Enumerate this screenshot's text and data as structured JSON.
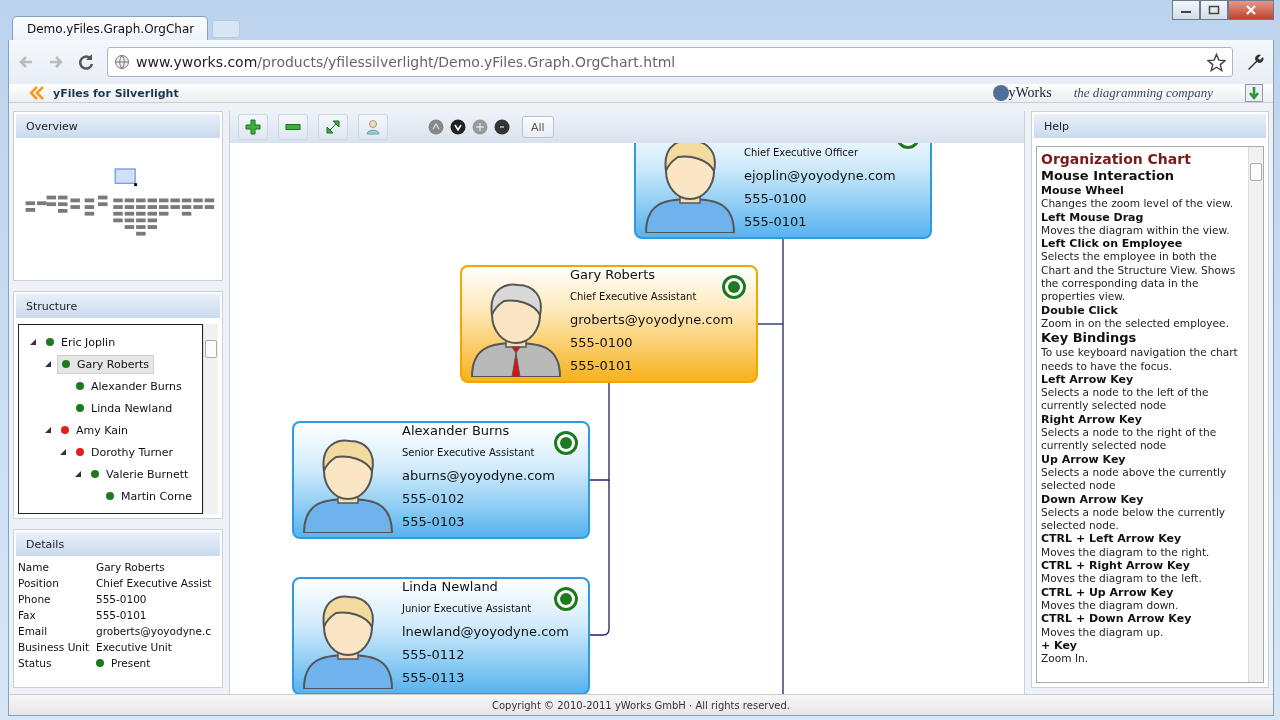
{
  "browser": {
    "tab_title": "Demo.yFiles.Graph.OrgChar",
    "url_host": "www.yworks.com",
    "url_path": "/products/yfilessilverlight/Demo.yFiles.Graph.OrgChart.html"
  },
  "page_header": {
    "product": "yFiles for Silverlight",
    "logo_text": "yWorks",
    "tagline": "the diagramming company"
  },
  "overview": {
    "title": "Overview"
  },
  "structure": {
    "title": "Structure",
    "items": [
      {
        "name": "Eric Joplin",
        "color": "#1e7a1e",
        "expanded": true,
        "selected": false,
        "children": [
          {
            "name": "Gary Roberts",
            "color": "#1e7a1e",
            "expanded": true,
            "selected": true,
            "children": [
              {
                "name": "Alexander Burns",
                "color": "#1e7a1e",
                "selected": false
              },
              {
                "name": "Linda Newland",
                "color": "#1e7a1e",
                "selected": false
              }
            ]
          },
          {
            "name": "Amy Kain",
            "color": "#e02020",
            "expanded": true,
            "selected": false,
            "children": [
              {
                "name": "Dorothy Turner",
                "color": "#e02020",
                "expanded": true,
                "selected": false,
                "children": [
                  {
                    "name": "Valerie Burnett",
                    "color": "#1e7a1e",
                    "expanded": true,
                    "selected": false,
                    "children": [
                      {
                        "name": "Martin Corne",
                        "color": "#1e7a1e",
                        "selected": false
                      }
                    ]
                  }
                ]
              }
            ]
          }
        ]
      }
    ]
  },
  "details": {
    "title": "Details",
    "rows": [
      {
        "label": "Name",
        "value": "Gary Roberts"
      },
      {
        "label": "Position",
        "value": "Chief Executive Assist"
      },
      {
        "label": "Phone",
        "value": "555-0100"
      },
      {
        "label": "Fax",
        "value": "555-0101"
      },
      {
        "label": "Email",
        "value": "groberts@yoyodyne.c"
      },
      {
        "label": "Business Unit",
        "value": "Executive Unit"
      },
      {
        "label": "Status",
        "value": "Present",
        "color": "#1e7a1e"
      }
    ]
  },
  "toolbar": {
    "all_button": "All"
  },
  "nodes": [
    {
      "title": "Chief Executive Officer",
      "email": "ejoplin@yoyodyne.com",
      "phone": "555-0100",
      "fax": "555-0101",
      "color": "#1e7a1e",
      "selected": false
    },
    {
      "name": "Gary Roberts",
      "title": "Chief Executive Assistant",
      "email": "groberts@yoyodyne.com",
      "phone": "555-0100",
      "fax": "555-0101",
      "color": "#1e7a1e",
      "selected": true
    },
    {
      "name": "Alexander Burns",
      "title": "Senior Executive Assistant",
      "email": "aburns@yoyodyne.com",
      "phone": "555-0102",
      "fax": "555-0103",
      "color": "#1e7a1e",
      "selected": false
    },
    {
      "name": "Linda Newland",
      "title": "Junior Executive Assistant",
      "email": "lnewland@yoyodyne.com",
      "phone": "555-0112",
      "fax": "555-0113",
      "color": "#1e7a1e",
      "selected": false
    }
  ],
  "help": {
    "title": "Help",
    "items": [
      {
        "kind": "title",
        "text": "Organization Chart"
      },
      {
        "kind": "section",
        "text": "Mouse Interaction"
      },
      {
        "kind": "term",
        "text": "Mouse Wheel"
      },
      {
        "kind": "desc",
        "text": "Changes the zoom level of the view."
      },
      {
        "kind": "term",
        "text": "Left Mouse Drag"
      },
      {
        "kind": "desc",
        "text": "Moves the diagram within the view."
      },
      {
        "kind": "term",
        "text": "Left Click on Employee"
      },
      {
        "kind": "desc",
        "text": "Selects the employee in both the Chart and the Structure View. Shows the corresponding data in the properties view."
      },
      {
        "kind": "term",
        "text": "Double Click"
      },
      {
        "kind": "desc",
        "text": "Zoom in on the selected employee."
      },
      {
        "kind": "section",
        "text": "Key Bindings"
      },
      {
        "kind": "desc",
        "text": "To use keyboard navigation the chart needs to have the focus."
      },
      {
        "kind": "term",
        "text": "Left Arrow Key"
      },
      {
        "kind": "desc",
        "text": "Selects a node to the left of the currently selected node"
      },
      {
        "kind": "term",
        "text": "Right Arrow Key"
      },
      {
        "kind": "desc",
        "text": "Selects a node to the right of the currently selected node"
      },
      {
        "kind": "term",
        "text": "Up Arrow Key"
      },
      {
        "kind": "desc",
        "text": "Selects a node above the currently selected node"
      },
      {
        "kind": "term",
        "text": "Down Arrow Key"
      },
      {
        "kind": "desc",
        "text": "Selects a node below the currently selected node."
      },
      {
        "kind": "term",
        "text": "CTRL + Left Arrow Key"
      },
      {
        "kind": "desc",
        "text": "Moves the diagram to the right."
      },
      {
        "kind": "term",
        "text": "CTRL + Right Arrow Key"
      },
      {
        "kind": "desc",
        "text": "Moves the diagram to the left."
      },
      {
        "kind": "term",
        "text": "CTRL + Up Arrow Key"
      },
      {
        "kind": "desc",
        "text": "Moves the diagram down."
      },
      {
        "kind": "term",
        "text": "CTRL + Down Arrow Key"
      },
      {
        "kind": "desc",
        "text": "Moves the diagram up."
      },
      {
        "kind": "term",
        "text": "+ Key"
      },
      {
        "kind": "desc",
        "text": "Zoom In."
      }
    ]
  },
  "footer": {
    "text": "Copyright © 2010-2011 yWorks GmbH · All rights reserved."
  }
}
